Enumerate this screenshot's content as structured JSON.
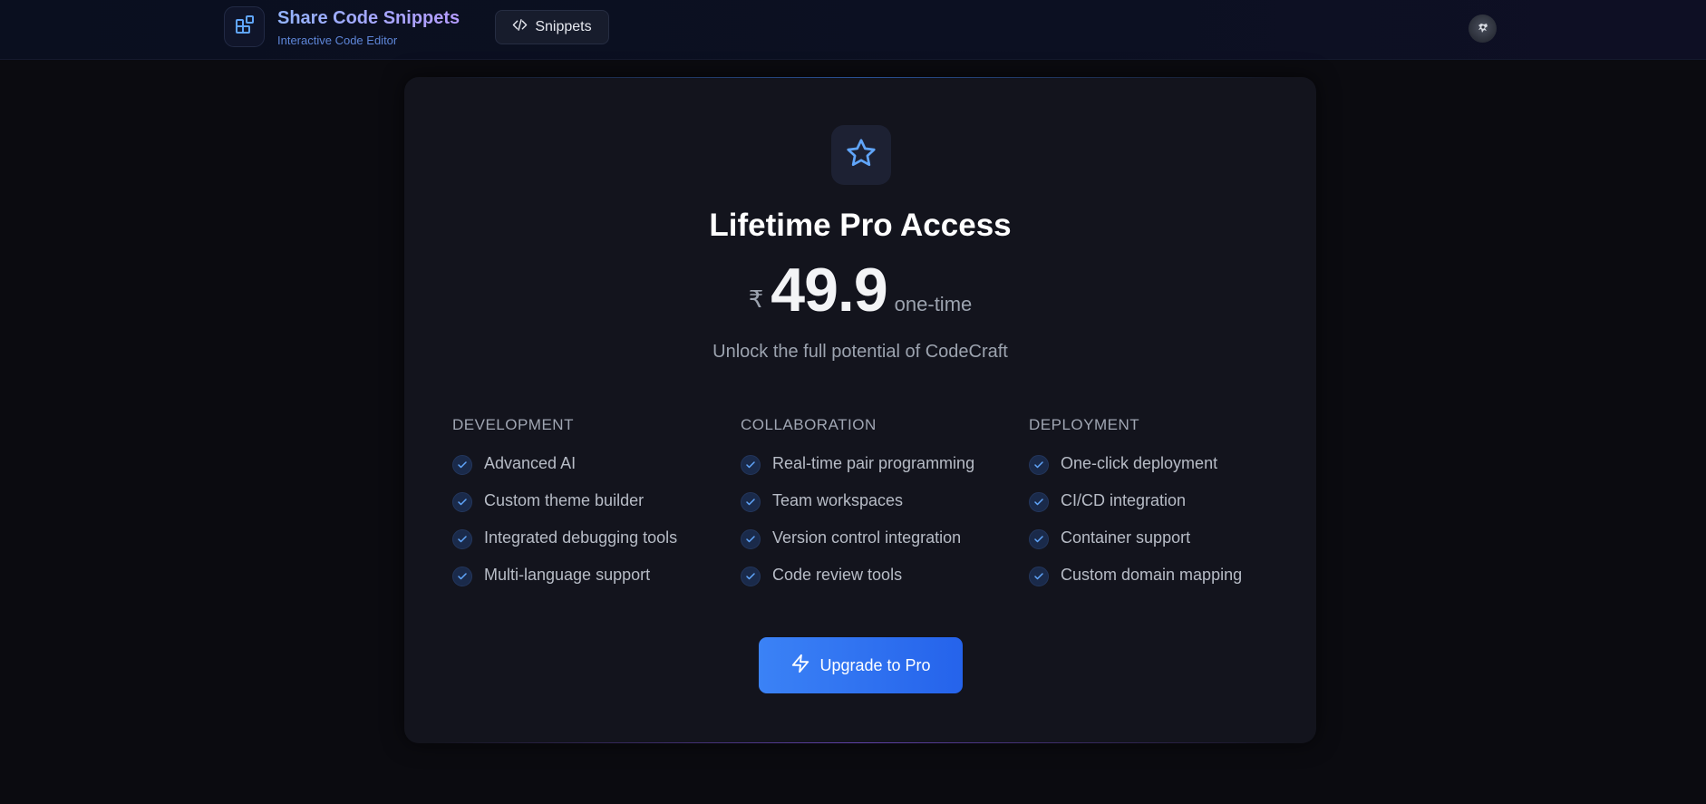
{
  "header": {
    "brand_title": "Share Code Snippets",
    "brand_subtitle": "Interactive Code Editor",
    "snippets_label": "Snippets",
    "logo_icon": "blocks-icon",
    "snippets_icon": "code-icon",
    "avatar_icon": "user-avatar"
  },
  "card": {
    "icon": "star-icon",
    "title": "Lifetime Pro Access",
    "currency": "₹",
    "price": "49.9",
    "period": "one-time",
    "subtitle": "Unlock the full potential of CodeCraft",
    "columns": [
      {
        "heading": "DEVELOPMENT",
        "items": [
          "Advanced AI",
          "Custom theme builder",
          "Integrated debugging tools",
          "Multi-language support"
        ]
      },
      {
        "heading": "COLLABORATION",
        "items": [
          "Real-time pair programming",
          "Team workspaces",
          "Version control integration",
          "Code review tools"
        ]
      },
      {
        "heading": "DEPLOYMENT",
        "items": [
          "One-click deployment",
          "CI/CD integration",
          "Container support",
          "Custom domain mapping"
        ]
      }
    ],
    "button_label": "Upgrade to Pro",
    "button_icon": "zap-icon"
  },
  "colors": {
    "accent": "#3b82f6",
    "background": "#0b0b10",
    "card": "#13141d"
  }
}
